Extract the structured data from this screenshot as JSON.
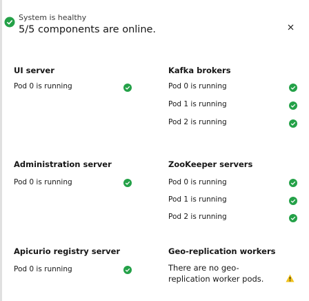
{
  "header": {
    "status_label": "System is healthy",
    "summary": "5/5 components are online."
  },
  "left_column": [
    {
      "title": "UI server",
      "pods": [
        {
          "label": "Pod 0 is running",
          "status": "success"
        }
      ]
    },
    {
      "title": "Administration server",
      "pods": [
        {
          "label": "Pod 0 is running",
          "status": "success"
        }
      ]
    },
    {
      "title": "Apicurio registry server",
      "pods": [
        {
          "label": "Pod 0 is running",
          "status": "success"
        }
      ]
    }
  ],
  "right_column": [
    {
      "title": "Kafka brokers",
      "pods": [
        {
          "label": "Pod 0 is running",
          "status": "success"
        },
        {
          "label": "Pod 1 is running",
          "status": "success"
        },
        {
          "label": "Pod 2 is running",
          "status": "success"
        }
      ]
    },
    {
      "title": "ZooKeeper servers",
      "pods": [
        {
          "label": "Pod 0 is running",
          "status": "success"
        },
        {
          "label": "Pod 1 is running",
          "status": "success"
        },
        {
          "label": "Pod 2 is running",
          "status": "success"
        }
      ]
    },
    {
      "title": "Geo-replication workers",
      "message": "There are no geo-replication worker pods.",
      "status": "warning"
    }
  ],
  "colors": {
    "success": "#24a148",
    "warning": "#f1c21b",
    "panel_bg": "#ffffff",
    "page_bg": "#e0e0e0"
  },
  "icons": {
    "header": "checkmark-filled-icon",
    "success": "checkmark-filled-icon",
    "warning": "warning-triangle-icon",
    "close": "close-icon"
  }
}
